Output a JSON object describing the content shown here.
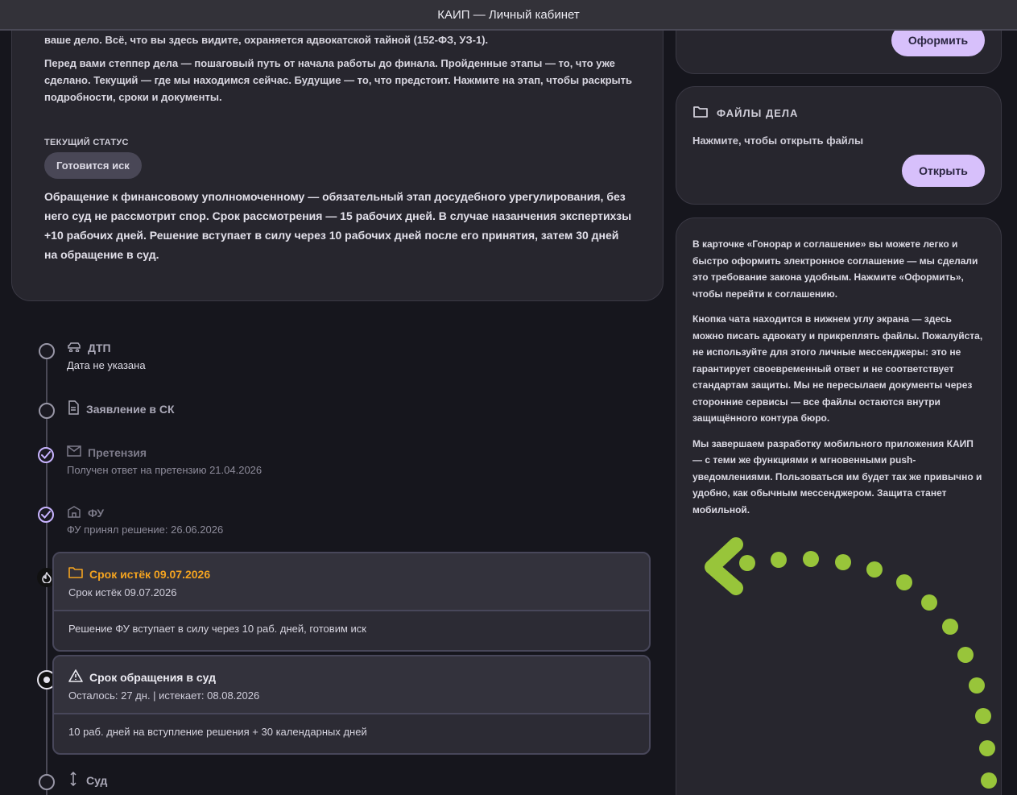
{
  "window": {
    "title": "КАИП — Личный кабинет"
  },
  "intro": {
    "p1": "ваше дело. Всё, что вы здесь видите, охраняется адвокатской тайной (152-ФЗ, УЗ-1).",
    "p2": "Перед вами степпер дела — пошаговый путь от начала работы до финала. Пройденные этапы — то, что уже сделано. Текущий — где мы находимся сейчас. Будущие — то, что предстоит. Нажмите на этап, чтобы раскрыть подробности, сроки и документы.",
    "status_label": "ТЕКУЩИЙ СТАТУС",
    "status_value": "Готовится иск",
    "status_desc": "Обращение к финансовому уполномоченному — обязательный этап досудебного урегулирования, без него суд не рассмотрит спор. Срок рассмотрения — 15 рабочих дней. В случае назанчения экспертихзы +10 рабочих дней. Решение вступает в силу через 10 рабочих дней после его принятия, затем 30 дней на обращение в суд."
  },
  "agreement_card": {
    "button": "Оформить"
  },
  "files_card": {
    "title": "ФАЙЛЫ ДЕЛА",
    "subtitle": "Нажмите, чтобы открыть файлы",
    "button": "Открыть"
  },
  "info_card": {
    "p1": "В карточке «Гонорар и соглашение» вы можете легко и быстро оформить электронное соглашение — мы сделали это требование закона удобным. Нажмите «Оформить», чтобы перейти к соглашению.",
    "p2": "Кнопка чата находится в нижнем углу экрана — здесь можно писать адвокату и прикреплять файлы. Пожалуйста, не используйте для этого личные мессенджеры: это не гарантирует своевременный ответ и не соответствует стандартам защиты. Мы не пересылаем документы через сторонние сервисы — все файлы остаются внутри защищённого контура бюро.",
    "p3": "Мы завершаем разработку мобильного приложения КАИП — с теми же функциями и мгновенными push-уведомлениями. Пользоваться им будет так же привычно и удобно, как обычным мессенджером. Защита станет мобильной."
  },
  "timeline": {
    "steps": [
      {
        "title": "ДТП",
        "subtitle": "Дата не указана",
        "icon": "car-icon",
        "state": "pending"
      },
      {
        "title": "Заявление в СК",
        "subtitle": "",
        "icon": "document-icon",
        "state": "pending"
      },
      {
        "title": "Претензия",
        "subtitle": "Получен ответ на претензию 21.04.2026",
        "icon": "mail-icon",
        "state": "done"
      },
      {
        "title": "ФУ",
        "subtitle": "ФУ принял решение: 26.06.2026",
        "icon": "building-icon",
        "state": "done"
      },
      {
        "title": "Срок истёк 09.07.2026",
        "subtitle": "Срок истёк 09.07.2026",
        "detail": "Решение ФУ вступает в силу через 10 раб. дней, готовим иск",
        "icon": "folder-icon",
        "state": "active"
      },
      {
        "title": "Срок обращения в суд",
        "subtitle": "Осталось: 27 дн. | истекает: 08.08.2026",
        "detail": "10 раб. дней на вступление решения + 30 календарных дней",
        "icon": "warning-icon",
        "state": "current"
      },
      {
        "title": "Суд",
        "subtitle": "",
        "icon": "gavel-icon",
        "state": "pending"
      }
    ]
  },
  "colors": {
    "accent": "#d7c0fb",
    "orange": "#f3a320",
    "green": "#98c53a"
  }
}
